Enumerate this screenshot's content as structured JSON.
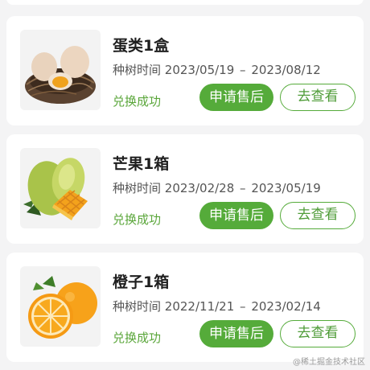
{
  "orders": [
    {
      "item_name": "蛋类1盒",
      "image_icon": "eggs-in-nest-image",
      "period_label": "种树时间",
      "period_start": "2023/05/19",
      "period_sep": "–",
      "period_end": "2023/08/12",
      "status": "兑换成功",
      "after_sale_label": "申请售后",
      "view_label": "去查看"
    },
    {
      "item_name": "芒果1箱",
      "image_icon": "mango-image",
      "period_label": "种树时间",
      "period_start": "2023/02/28",
      "period_sep": "–",
      "period_end": "2023/05/19",
      "status": "兑换成功",
      "after_sale_label": "申请售后",
      "view_label": "去查看"
    },
    {
      "item_name": "橙子1箱",
      "image_icon": "orange-image",
      "period_label": "种树时间",
      "period_start": "2022/11/21",
      "period_sep": "–",
      "period_end": "2023/02/14",
      "status": "兑换成功",
      "after_sale_label": "申请售后",
      "view_label": "去查看"
    }
  ],
  "colors": {
    "accent_green": "#55ab3a",
    "status_green": "#5aa63a",
    "page_background": "#f4f4f5"
  },
  "watermark": "@稀土掘金技术社区"
}
